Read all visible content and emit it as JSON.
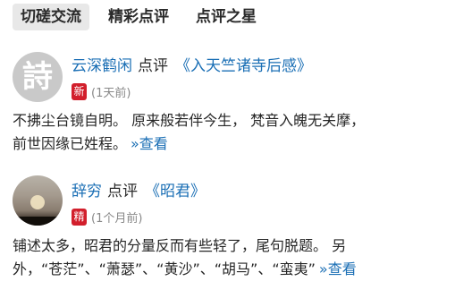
{
  "tabs": [
    {
      "label": "切磋交流",
      "active": true
    },
    {
      "label": "精彩点评",
      "active": false
    },
    {
      "label": "点评之星",
      "active": false
    }
  ],
  "reviews": [
    {
      "avatar_glyph": "詩",
      "author": "云深鹤闲",
      "label": "点评",
      "poem": "《入天竺诸寺后感》",
      "badge": "新",
      "time_ago": "(1天前)",
      "line1": "不拂尘台镜自明。 原来般若伴今生， 梵音入魄无关摩，",
      "line2": "前世因缘已姓程。",
      "more": "»查看"
    },
    {
      "author": "辞穷",
      "label": "点评",
      "poem": "《昭君》",
      "badge": "精",
      "time_ago": "(1个月前)",
      "line1": "铺述太多，昭君的分量反而有些轻了，尾句脱题。 另",
      "line2": "外，“苍茫”、“萧瑟”、“黄沙”、“胡马”、“蛮夷”",
      "more": "»查看"
    }
  ],
  "colors": {
    "link": "#1b6fb5",
    "badge": "#d21f2c",
    "active_tab_bg": "#e8e8e8"
  }
}
